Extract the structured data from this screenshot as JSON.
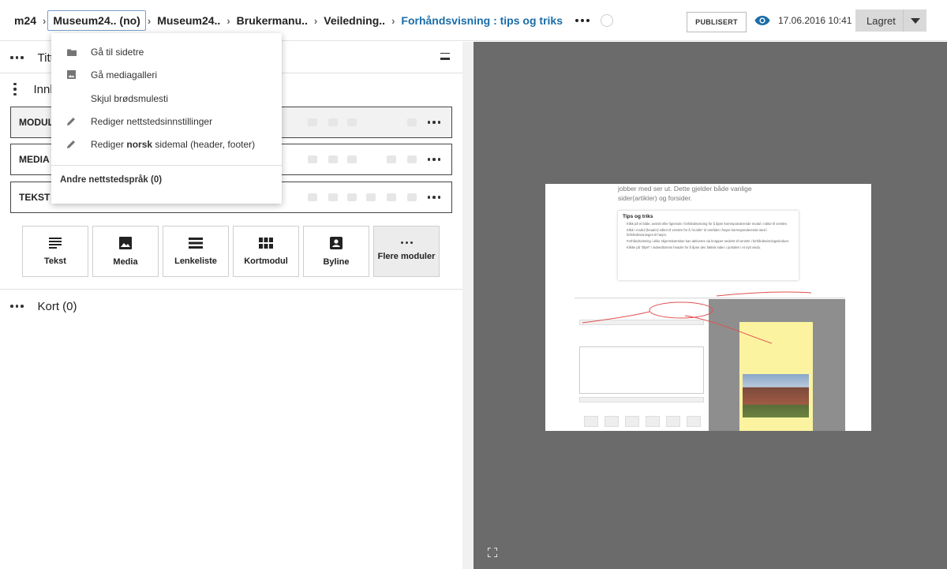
{
  "breadcrumb": {
    "items": [
      {
        "label": "m24"
      },
      {
        "label": "Museum24.. (no)"
      },
      {
        "label": "Museum24.."
      },
      {
        "label": "Brukermanu.."
      },
      {
        "label": "Veiledning.."
      },
      {
        "label": "Forhåndsvisning : tips og triks"
      }
    ]
  },
  "header": {
    "publish_label": "PUBLISERT",
    "date": "17.06.2016 10:41",
    "save_label": "Lagret",
    "colors": {
      "accent": "#1a6da8",
      "save_bg": "#d9d9d9"
    }
  },
  "dropdown": {
    "items": [
      {
        "icon": "folder-icon",
        "label": "Gå til sidetre"
      },
      {
        "icon": "image-icon",
        "label": "Gå mediagalleri"
      },
      {
        "icon": "",
        "label": "Skjul brødsmulesti"
      },
      {
        "icon": "pencil-icon",
        "label": "Rediger nettstedsinnstillinger"
      },
      {
        "icon": "pencil-icon",
        "label_pre": "Rediger ",
        "label_bold": "norsk",
        "label_post": " sidemal (header, footer)"
      }
    ],
    "footer": "Andre nettstedspråk (0)"
  },
  "left": {
    "title_section": "Tittel",
    "content_section": "Innhold",
    "modules": [
      {
        "label": "MODUL:"
      },
      {
        "label": "MEDIA :"
      },
      {
        "label": "TEKST :"
      }
    ],
    "tiles": [
      {
        "icon": "text-lines-icon",
        "label": "Tekst"
      },
      {
        "icon": "image-icon",
        "label": "Media"
      },
      {
        "icon": "list-icon",
        "label": "Lenkeliste"
      },
      {
        "icon": "grid-icon",
        "label": "Kortmodul"
      },
      {
        "icon": "contact-card-icon",
        "label": "Byline"
      },
      {
        "icon": "more-icon",
        "label": "Flere moduler"
      }
    ],
    "cards_section": "Kort (0)"
  },
  "preview": {
    "intro": "jobber med ser ut. Dette gjelder både vanlige sider(artikler) og forsider.",
    "tips_title": "Tips og triks",
    "tips": [
      "Klikk på et bilde, avsnitt eller lignende i forhåndsvisning for å åpne korresponderende modul i editor til venstre.",
      "Klikk i modul (header) editor til venstre for å \"scrolle\" til området i høyre korresponderende sted i forhåndsvisningen til høyre.",
      "Forhåndsvisning i ulike skjermstørrelser kan aktiveres via knapper nederst til venstre i forhåndsvisningsvinduet.",
      "Klikke på \"Øyet\" i sideeditorens header for å åpne den faktisk siden i portalen i et nytt vindu."
    ]
  }
}
